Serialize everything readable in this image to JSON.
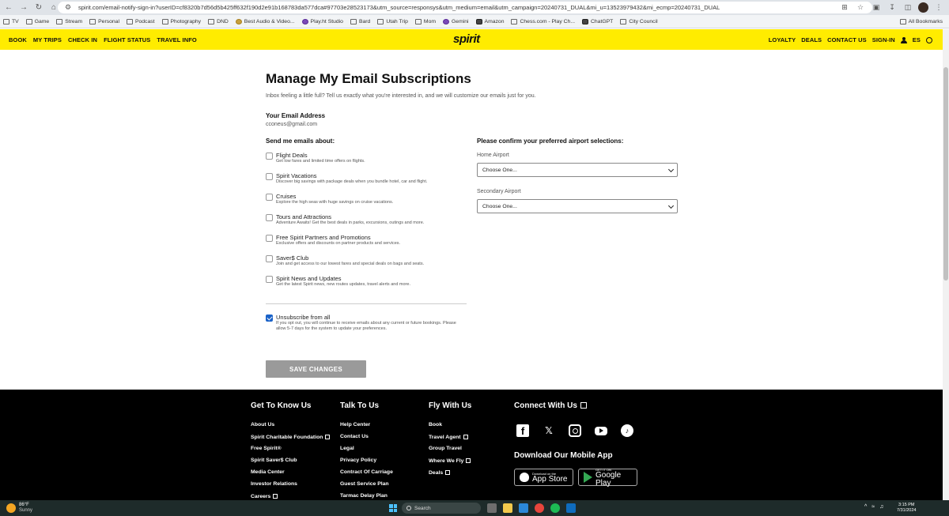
{
  "browser": {
    "url": "spirit.com/email-notify-sign-in?userID=cf8320b7d56d5b425ff632f190d2e91b168783da577dca#97703e28523173&utm_source=responsys&utm_medium=email&utm_campaign=20240731_DUAL&mi_u=13523979432&mi_ecmp=20240731_DUAL",
    "bookmarks": [
      "TV",
      "Game",
      "Stream",
      "Personal",
      "Podcast",
      "Photography",
      "DND",
      "Best Audio & Video...",
      "Play.ht Studio",
      "Bard",
      "Utah Trip",
      "Mom",
      "Gemini",
      "Amazon",
      "Chess.com - Play Ch...",
      "ChatGPT",
      "City Council"
    ],
    "all_bookmarks": "All Bookmarks"
  },
  "header": {
    "nav_left": [
      "BOOK",
      "MY TRIPS",
      "CHECK IN",
      "FLIGHT STATUS",
      "TRAVEL INFO"
    ],
    "logo": "spirit",
    "nav_right": [
      "LOYALTY",
      "DEALS",
      "CONTACT US",
      "SIGN-IN"
    ],
    "language": "ES"
  },
  "main": {
    "title": "Manage My Email Subscriptions",
    "intro": "Inbox feeling a little full? Tell us exactly what you're interested in, and we will customize our emails just for you.",
    "email_label": "Your Email Address",
    "email_value": "cconeus@gmail.com",
    "send_heading": "Send me emails about:",
    "options": [
      {
        "title": "Flight Deals",
        "desc": "Get low fares and limited time offers on flights.",
        "checked": false
      },
      {
        "title": "Spirit Vacations",
        "desc": "Discover big savings with package deals when you bundle hotel, car and flight.",
        "checked": false
      },
      {
        "title": "Cruises",
        "desc": "Explore the high seas with huge savings on cruise vacations.",
        "checked": false
      },
      {
        "title": "Tours and Attractions",
        "desc": "Adventure Awaits! Get the best deals in parks, excursions, outings and more.",
        "checked": false
      },
      {
        "title": "Free Spirit Partners and Promotions",
        "desc": "Exclusive offers and discounts on partner products and services.",
        "checked": false
      },
      {
        "title": "Saver$ Club",
        "desc": "Join and get access to our lowest fares and special deals on bags and seats.",
        "checked": false
      },
      {
        "title": "Spirit News and Updates",
        "desc": "Get the latest Spirit news, new routes updates, travel alerts and more.",
        "checked": false
      }
    ],
    "unsubscribe": {
      "title": "Unsubscribe from all",
      "desc": "If you opt out, you will continue to receive emails about any current or future bookings. Please allow 5-7 days for the system to update your preferences.",
      "checked": true
    },
    "save_button": "SAVE CHANGES",
    "airport_heading": "Please confirm your preferred airport selections:",
    "home_airport_label": "Home Airport",
    "home_airport_value": "Choose One...",
    "secondary_airport_label": "Secondary Airport",
    "secondary_airport_value": "Choose One..."
  },
  "footer": {
    "col1": {
      "heading": "Get To Know Us",
      "links": [
        "About Us",
        "Spirit Charitable Foundation",
        "Free Spirit®",
        "Spirit Saver$ Club",
        "Media Center",
        "Investor Relations",
        "Careers"
      ]
    },
    "col2": {
      "heading": "Talk To Us",
      "links": [
        "Help Center",
        "Contact Us",
        "Legal",
        "Privacy Policy",
        "Contract Of Carriage",
        "Guest Service Plan",
        "Tarmac Delay Plan"
      ]
    },
    "col3": {
      "heading": "Fly With Us",
      "links": [
        "Book",
        "Travel Agent",
        "Group Travel",
        "Where We Fly",
        "Deals"
      ]
    },
    "connect_heading": "Connect With Us",
    "app_heading": "Download Our Mobile App",
    "app_store_small": "Download on the",
    "app_store_big": "App Store",
    "play_small": "GET IT ON",
    "play_big": "Google Play"
  },
  "taskbar": {
    "temp": "86°F",
    "condition": "Sunny",
    "search_placeholder": "Search",
    "time": "3:15 PM",
    "date": "7/31/2024"
  }
}
